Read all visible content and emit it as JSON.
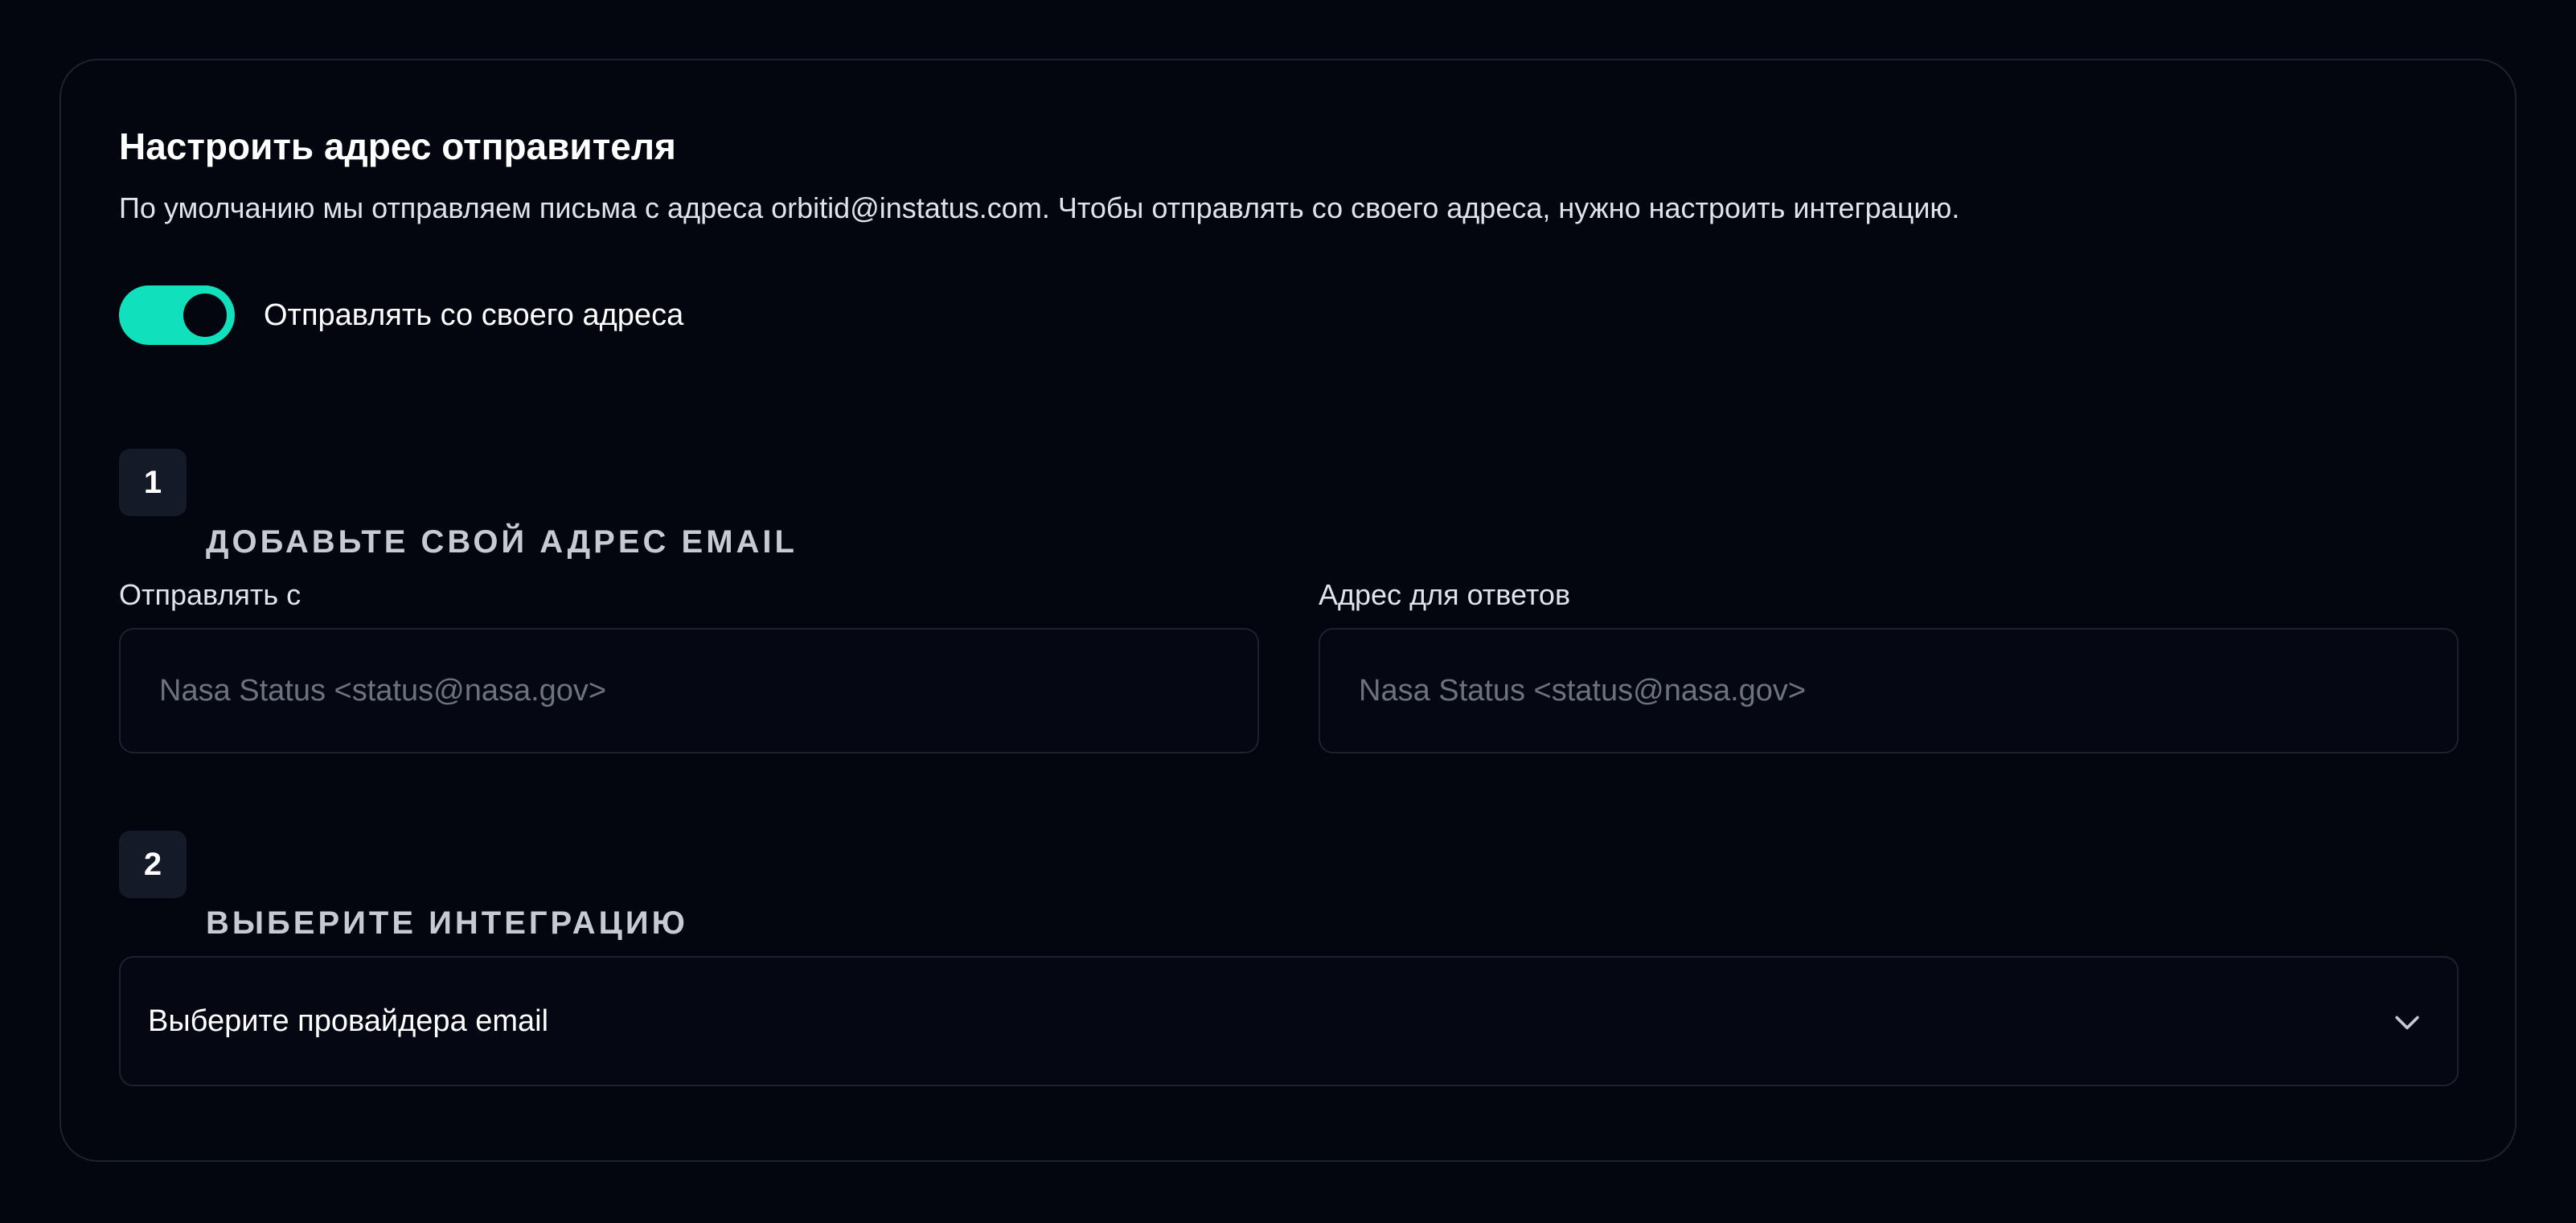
{
  "section": {
    "title": "Настроить адрес отправителя",
    "description": "По умолчанию мы отправляем письма с адреса orbitid@instatus.com. Чтобы отправлять со своего адреса, нужно настроить интеграцию."
  },
  "toggle": {
    "label": "Отправлять со своего адреса",
    "checked": true,
    "color": "#11e0bd"
  },
  "step1": {
    "number": "1",
    "title": "ДОБАВЬТЕ СВОЙ АДРЕС EMAIL",
    "from": {
      "label": "Отправлять с",
      "value": "",
      "placeholder": "Nasa Status <status@nasa.gov>"
    },
    "reply_to": {
      "label": "Адрес для ответов",
      "value": "",
      "placeholder": "Nasa Status <status@nasa.gov>"
    }
  },
  "step2": {
    "number": "2",
    "title": "ВЫБЕРИТЕ ИНТЕГРАЦИЮ",
    "select": {
      "value": "Выберите провайдера email",
      "icon": "chevron-down-icon"
    }
  }
}
